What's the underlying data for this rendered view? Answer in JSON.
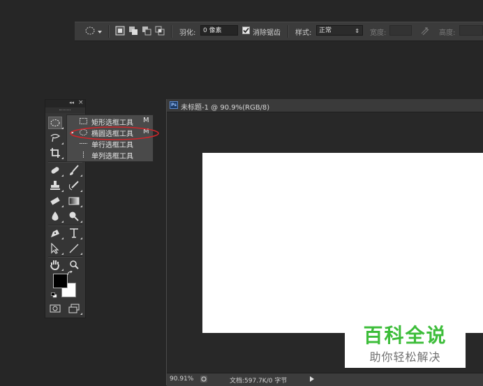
{
  "options_bar": {
    "feather_label": "羽化:",
    "feather_value": "0 像素",
    "antialias_label": "消除锯齿",
    "antialias_checked": true,
    "style_label": "样式:",
    "style_value": "正常",
    "width_label": "宽度:",
    "height_label": "高度:"
  },
  "toolbox": {
    "collapse_glyph": "◂◂",
    "close_glyph": "×"
  },
  "flyout": {
    "items": [
      {
        "label": "矩形选框工具",
        "shortcut": "M",
        "selected": false,
        "icon": "rect-marquee-icon"
      },
      {
        "label": "椭圆选框工具",
        "shortcut": "M",
        "selected": true,
        "icon": "ellipse-marquee-icon"
      },
      {
        "label": "单行选框工具",
        "shortcut": "",
        "selected": false,
        "icon": "single-row-marquee-icon"
      },
      {
        "label": "单列选框工具",
        "shortcut": "",
        "selected": false,
        "icon": "single-column-marquee-icon"
      }
    ],
    "highlight_color": "#d0262b"
  },
  "document": {
    "ps_badge": "Ps",
    "title": "未标题-1 @ 90.9%(RGB/8)",
    "zoom": "90.91%",
    "info": "文档:597.7K/0 字节"
  },
  "watermark": {
    "title": "百科全说",
    "subtitle": "助你轻松解决",
    "title_color": "#3dbd3a"
  },
  "colors": {
    "foreground": "#000000",
    "background": "#ffffff"
  }
}
